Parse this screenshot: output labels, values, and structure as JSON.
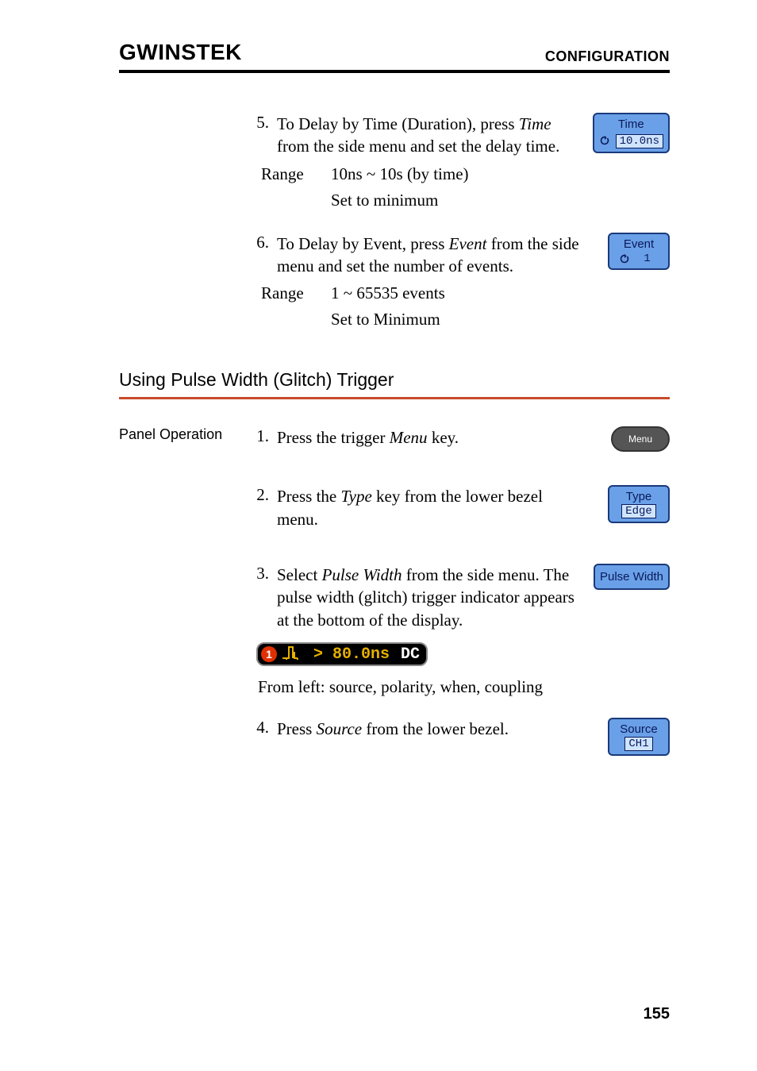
{
  "header": {
    "brand": "GWINSTEK",
    "section": "CONFIGURATION"
  },
  "steps_a": [
    {
      "num": "5.",
      "text_pre": "To Delay by Time (Duration), press ",
      "em": "Time",
      "text_post": " from the side menu and set the delay time.",
      "btn": {
        "title": "Time",
        "value": "10.0ns",
        "has_knob": true
      },
      "sub": [
        {
          "label": "Range",
          "value": "10ns ~ 10s (by time)"
        },
        {
          "label": "",
          "value": "Set to minimum"
        }
      ]
    },
    {
      "num": "6.",
      "text_pre": "To Delay by Event, press ",
      "em": "Event",
      "text_post": " from the side menu and set the number of events.",
      "btn": {
        "title": "Event",
        "value": "1",
        "has_knob": true
      },
      "sub": [
        {
          "label": "Range",
          "value": "1 ~ 65535  events"
        },
        {
          "label": "",
          "value": "Set to Minimum"
        }
      ]
    }
  ],
  "section_title": "Using Pulse Width (Glitch) Trigger",
  "panel_label": "Panel Operation",
  "steps_b": {
    "s1": {
      "num": "1.",
      "text_pre": "Press the trigger ",
      "em": "Menu",
      "text_post": " key.",
      "key_label": "Menu"
    },
    "s2": {
      "num": "2.",
      "text_pre": "Press the ",
      "em": "Type",
      "text_post": " key from the lower bezel menu.",
      "btn": {
        "title": "Type",
        "value": "Edge"
      }
    },
    "s3": {
      "num": "3.",
      "text_pre": "Select ",
      "em": "Pulse Width",
      "text_post": " from the side menu. The pulse width (glitch) trigger indicator appears at the bottom of the display.",
      "btn_label": "Pulse Width"
    },
    "indicator": {
      "channel": "1",
      "when": "> 80.0ns",
      "coupling": "DC"
    },
    "indicator_caption": "From left: source, polarity, when, coupling",
    "s4": {
      "num": "4.",
      "text_pre": "Press ",
      "em": "Source",
      "text_post": " from the lower bezel.",
      "btn": {
        "title": "Source",
        "value": "CH1"
      }
    }
  },
  "page_number": "155"
}
